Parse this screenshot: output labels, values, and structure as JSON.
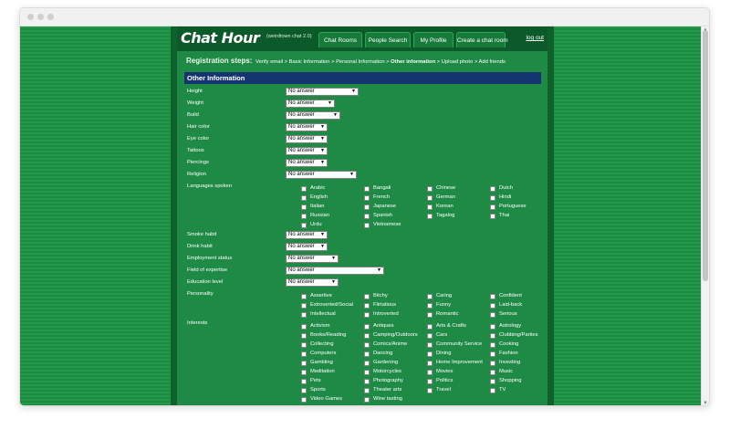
{
  "site": {
    "logo": "Chat Hour",
    "version": "(weirdtown chat 2.0)",
    "tabs": [
      "Chat Rooms",
      "People Search",
      "My Profile",
      "Create a chat room"
    ],
    "logout": "log out"
  },
  "steps": {
    "label": "Registration steps:",
    "items": [
      "Verify email",
      "Basic Information",
      "Personal Information",
      "Other information",
      "Upload photo",
      "Add friends"
    ],
    "current_index": 3,
    "separator": ">"
  },
  "section_title": "Other Information",
  "fields": [
    {
      "label": "Height",
      "value": "No answer"
    },
    {
      "label": "Weight",
      "value": "No answer"
    },
    {
      "label": "Build",
      "value": "No answer"
    },
    {
      "label": "Hair color",
      "value": "No answer"
    },
    {
      "label": "Eye color",
      "value": "No answer"
    },
    {
      "label": "Tattoos",
      "value": "No answer"
    },
    {
      "label": "Piercings",
      "value": "No answer"
    },
    {
      "label": "Religion",
      "value": "No answer"
    },
    {
      "label": "Languages spoken"
    },
    {
      "label": "Smoke habit",
      "value": "No answer"
    },
    {
      "label": "Drink habit",
      "value": "No answer"
    },
    {
      "label": "Employment status",
      "value": "No answer"
    },
    {
      "label": "Field of expertise",
      "value": "No answer"
    },
    {
      "label": "Education level",
      "value": "No answer"
    },
    {
      "label": "Personality"
    },
    {
      "label": "Interests"
    }
  ],
  "languages": [
    "Arabic",
    "Bangali",
    "Chinese",
    "Dutch",
    "English",
    "French",
    "German",
    "Hindi",
    "Italian",
    "Japanese",
    "Korean",
    "Portuguese",
    "Russian",
    "Spanish",
    "Tagalog",
    "Thai",
    "Urdu",
    "Vietnamese"
  ],
  "personality": [
    "Assertive",
    "Bitchy",
    "Caring",
    "Confident",
    "Extroverted/Social",
    "Flirtatious",
    "Funny",
    "Laid-back",
    "Intellectual",
    "Introverted",
    "Romantic",
    "Serious"
  ],
  "interests": [
    "Activism",
    "Antiques",
    "Arts & Crafts",
    "Astrology",
    "Books/Reading",
    "Camping/Outdoors",
    "Cars",
    "Clubbing/Parties",
    "Collecting",
    "Comics/Anime",
    "Community Service",
    "Cooking",
    "Computers",
    "Dancing",
    "Dining",
    "Fashion",
    "Gambling",
    "Gardening",
    "Home Improvement",
    "Investing",
    "Meditation",
    "Motorcycles",
    "Movies",
    "Music",
    "Pets",
    "Photography",
    "Politics",
    "Shopping",
    "Sports",
    "Theater arts",
    "Travel",
    "TV",
    "Video Games",
    "Wine tasting"
  ],
  "colors": {
    "background": "#239a4b",
    "header": "#0c5a2a",
    "section_bar": "#14356e",
    "content": "#1e8a46"
  }
}
